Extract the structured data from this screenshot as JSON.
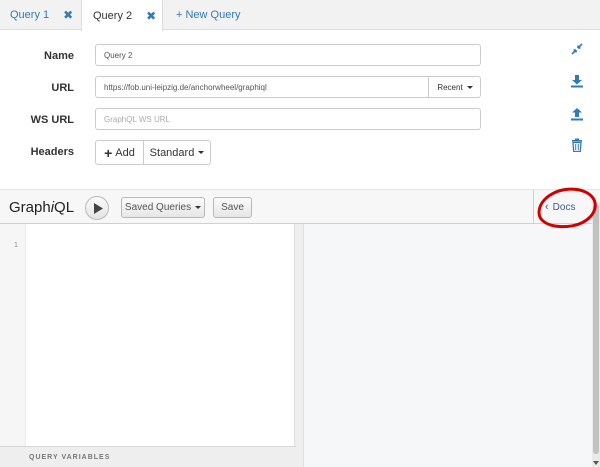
{
  "tabs": [
    {
      "label": "Query 1",
      "close": "✖"
    },
    {
      "label": "Query 2",
      "close": "✖"
    },
    {
      "label": "+ New Query"
    }
  ],
  "form": {
    "name_label": "Name",
    "name_value": "Query 2",
    "url_label": "URL",
    "url_value": "https://fob.uni-leipzig.de/anchorwheel/graphiql",
    "recent_label": "Recent",
    "ws_url_label": "WS URL",
    "ws_url_placeholder": "GraphQL WS URL",
    "headers_label": "Headers",
    "add_label": "Add",
    "add_icon": "+",
    "standard_label": "Standard"
  },
  "side_icons": [
    "compress-icon",
    "download-icon",
    "upload-icon",
    "trash-icon"
  ],
  "graphiql": {
    "title_prefix": "Graph",
    "title_italic": "i",
    "title_suffix": "QL",
    "saved_queries_label": "Saved Queries",
    "save_label": "Save",
    "docs_label": "Docs",
    "docs_chevron": "‹",
    "line_number": "1",
    "query_variables_label": "QUERY VARIABLES"
  },
  "colors": {
    "link": "#337ab7",
    "docs": "#3b5998",
    "annotation_red": "#d10000"
  }
}
